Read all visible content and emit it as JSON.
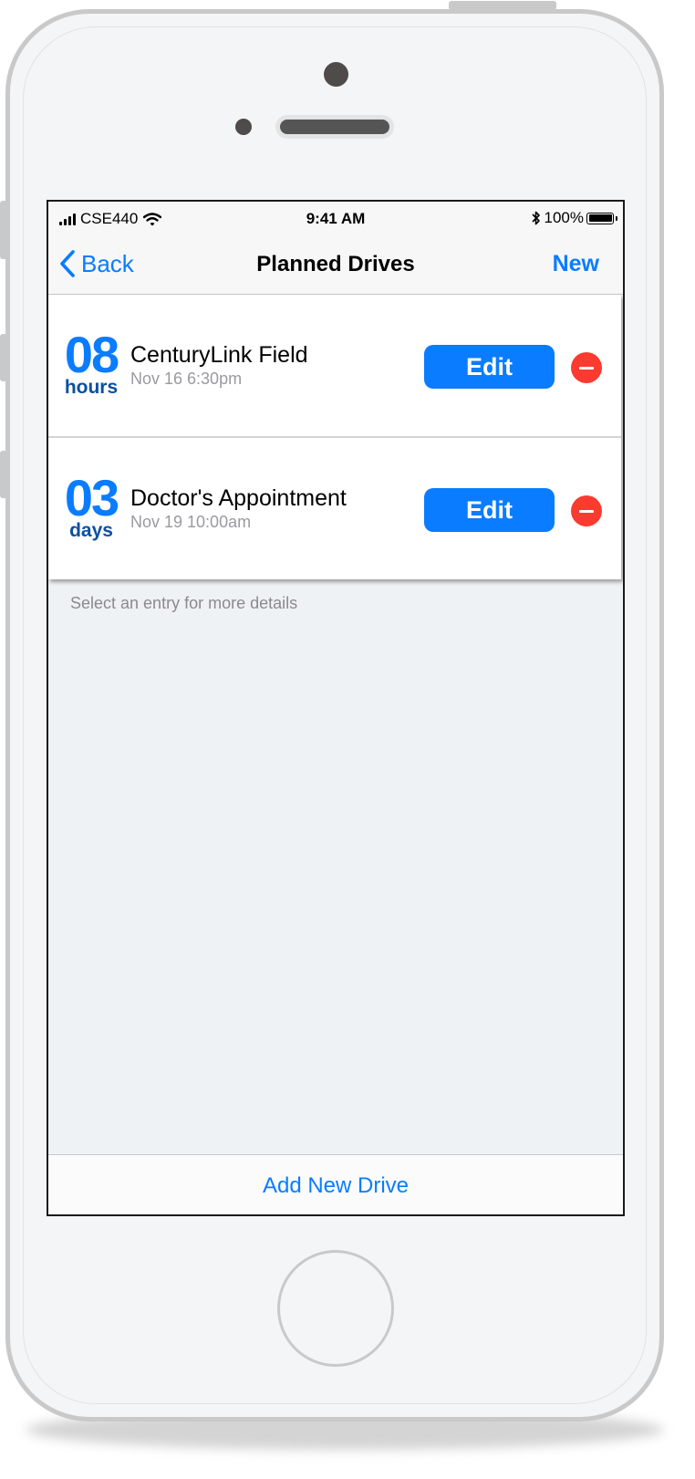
{
  "status_bar": {
    "carrier": "CSE440",
    "time": "9:41 AM",
    "battery_percent": "100%",
    "icons": [
      "signal-bars-icon",
      "wifi-icon",
      "bluetooth-icon",
      "battery-icon"
    ]
  },
  "nav": {
    "back_label": "Back",
    "title": "Planned Drives",
    "new_label": "New"
  },
  "drives": [
    {
      "count": "08",
      "unit": "hours",
      "title": "CenturyLink Field",
      "datetime": "Nov 16 6:30pm",
      "edit_label": "Edit"
    },
    {
      "count": "03",
      "unit": "days",
      "title": "Doctor's Appointment",
      "datetime": "Nov 19 10:00am",
      "edit_label": "Edit"
    }
  ],
  "hint": "Select an entry for more details",
  "bottom": {
    "add_label": "Add New Drive"
  },
  "colors": {
    "accent": "#0a7cff",
    "unit_text": "#0b4fa2",
    "delete": "#fb3b30",
    "screen_bg": "#eff2f5"
  }
}
